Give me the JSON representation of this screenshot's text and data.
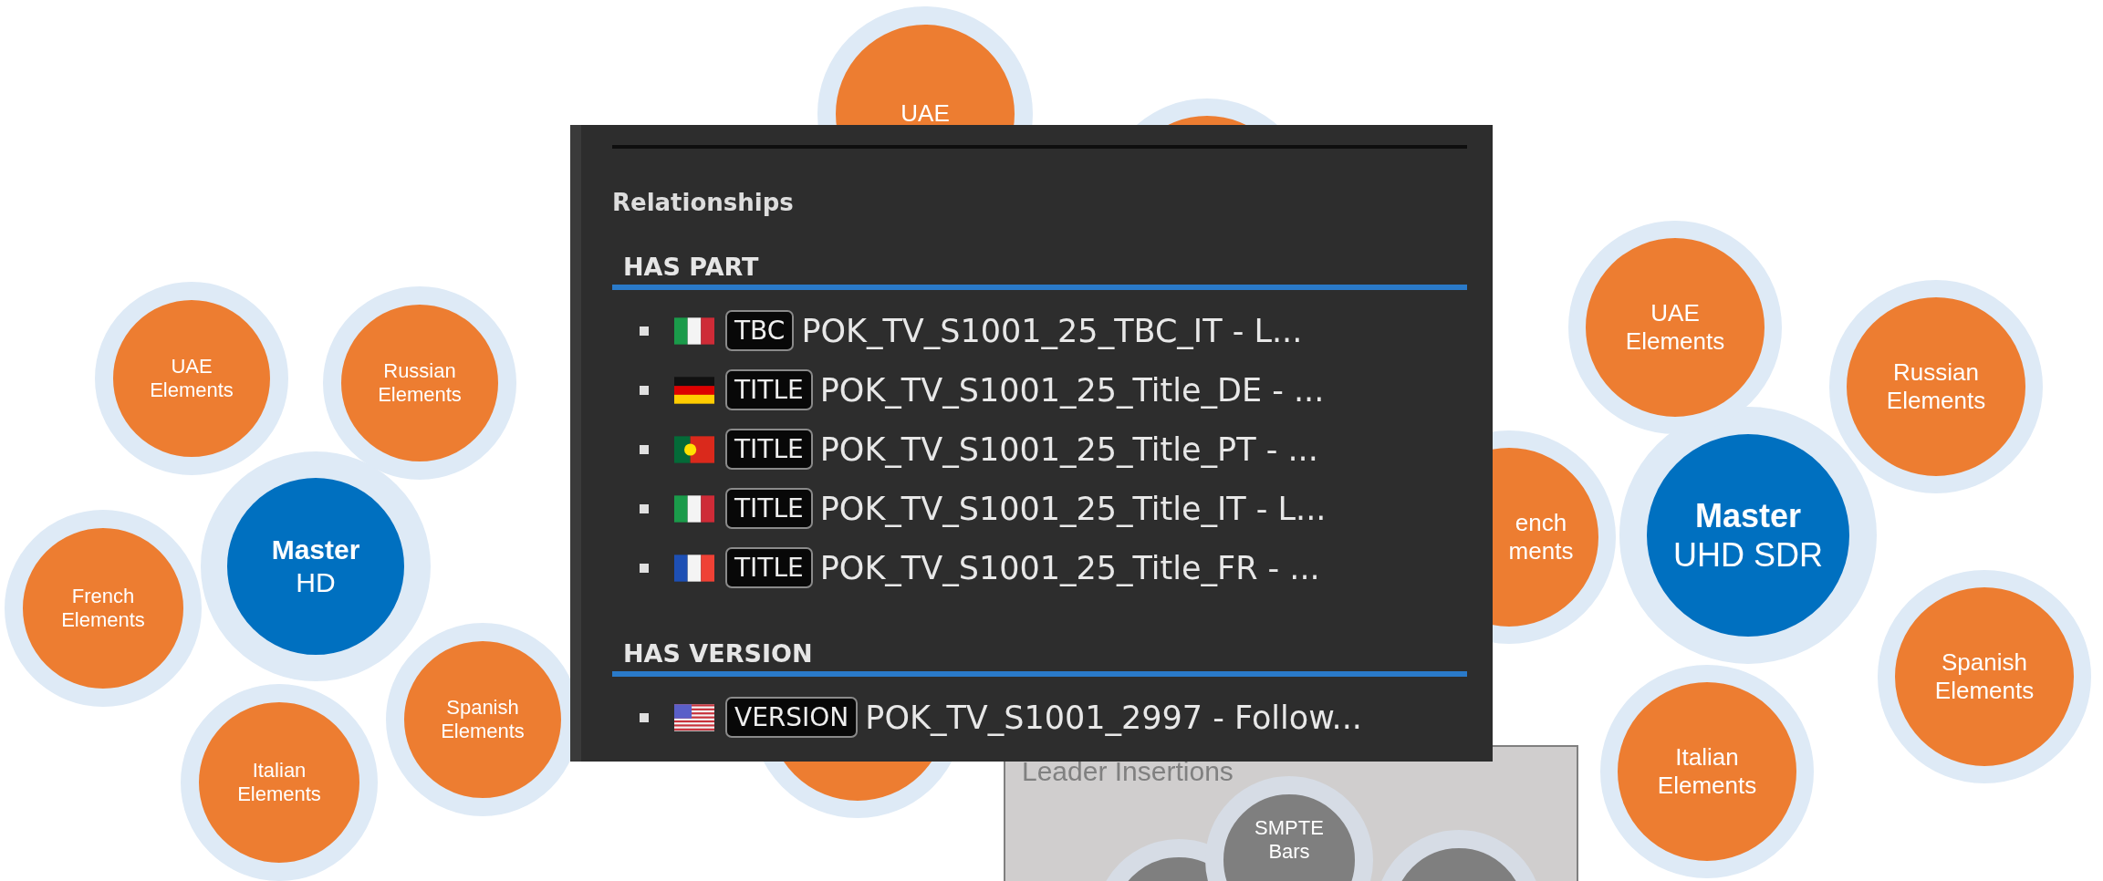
{
  "left_cluster": [
    {
      "kind": "master",
      "lines": [
        "Master",
        "HD"
      ]
    },
    {
      "kind": "element",
      "lines": [
        "UAE",
        "Elements"
      ]
    },
    {
      "kind": "element",
      "lines": [
        "Russian",
        "Elements"
      ]
    },
    {
      "kind": "element",
      "lines": [
        "French",
        "Elements"
      ]
    },
    {
      "kind": "element",
      "lines": [
        "Italian",
        "Elements"
      ]
    },
    {
      "kind": "element",
      "lines": [
        "Spanish",
        "Elements"
      ]
    }
  ],
  "center_cluster": [
    {
      "kind": "element",
      "lines": [
        "UAE"
      ]
    }
  ],
  "right_cluster": [
    {
      "kind": "master",
      "lines": [
        "Master",
        "UHD SDR"
      ]
    },
    {
      "kind": "element",
      "lines": [
        "UAE",
        "Elements"
      ]
    },
    {
      "kind": "element",
      "lines": [
        "Russian",
        "Elements"
      ]
    },
    {
      "kind": "element",
      "lines": [
        "ench",
        "ments"
      ]
    },
    {
      "kind": "element",
      "lines": [
        "Spanish",
        "Elements"
      ]
    },
    {
      "kind": "element",
      "lines": [
        "Italian",
        "Elements"
      ]
    }
  ],
  "leader_insertions": {
    "title": "Leader Insertions",
    "bubbles": [
      {
        "kind": "insert",
        "lines": [
          "SMPTE",
          "Bars"
        ]
      }
    ]
  },
  "panel": {
    "title": "Relationships",
    "sections": [
      {
        "heading": "HAS PART",
        "items": [
          {
            "kind": "italy",
            "tag": "TBC",
            "text": "POK_TV_S1001_25_TBC_IT - L..."
          },
          {
            "kind": "germany",
            "tag": "TITLE",
            "text": "POK_TV_S1001_25_Title_DE - ..."
          },
          {
            "kind": "portugal",
            "tag": "TITLE",
            "text": "POK_TV_S1001_25_Title_PT - ..."
          },
          {
            "kind": "italy",
            "tag": "TITLE",
            "text": "POK_TV_S1001_25_Title_IT - L..."
          },
          {
            "kind": "france",
            "tag": "TITLE",
            "text": "POK_TV_S1001_25_Title_FR - ..."
          }
        ]
      },
      {
        "heading": "HAS VERSION",
        "items": [
          {
            "kind": "usa",
            "tag": "VERSION",
            "text": "POK_TV_S1001_2997 - Follow..."
          }
        ]
      }
    ]
  }
}
